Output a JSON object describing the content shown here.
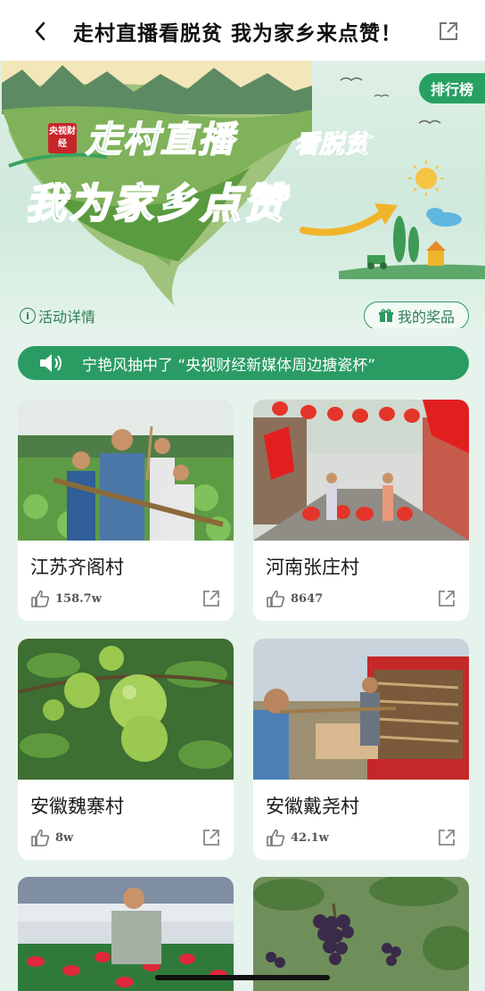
{
  "header": {
    "title": "走村直播看脱贫  我为家乡来点赞！",
    "back_icon": "chevron-left-icon",
    "share_icon": "share-icon"
  },
  "banner": {
    "rank_label": "排行榜",
    "cctv_badge": "央视财经",
    "headline_a": "走村直播",
    "headline_b": "看脱贫",
    "headline_c": "我为家乡点赞",
    "activity_link": "活动详情",
    "prize_label": "我的奖品"
  },
  "announcement": {
    "text": "宁艳风抽中了 “央视财经新媒体周边搪瓷杯”"
  },
  "villages": [
    {
      "name": "江苏齐阁村",
      "likes": "158.7w"
    },
    {
      "name": "河南张庄村",
      "likes": "8647"
    },
    {
      "name": "安徽魏寨村",
      "likes": "8w"
    },
    {
      "name": "安徽戴尧村",
      "likes": "42.1w"
    },
    {
      "name": "",
      "likes": ""
    },
    {
      "name": "",
      "likes": ""
    }
  ],
  "colors": {
    "accent": "#2a9c63",
    "page_bg": "#e6f3ec",
    "card_bg": "#ffffff"
  }
}
